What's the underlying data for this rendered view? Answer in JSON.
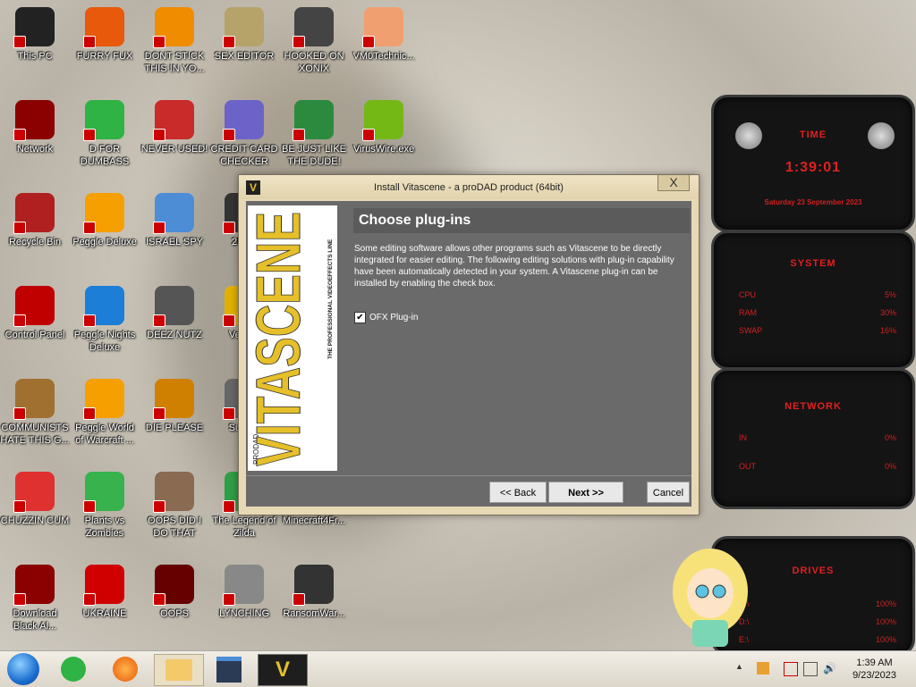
{
  "desktop": {
    "icons": [
      {
        "label": "This PC",
        "name": "this-pc-icon",
        "color": "#222"
      },
      {
        "label": "FURRY FUX",
        "name": "firefox-icon",
        "color": "#e8590c"
      },
      {
        "label": "DONT STICK THIS IN YO...",
        "name": "vlc-icon",
        "color": "#f08c00"
      },
      {
        "label": "SEX EDITOR",
        "name": "hxd-icon",
        "color": "#b5a36a"
      },
      {
        "label": "HOOKED ON XONIX",
        "name": "xonix-icon",
        "color": "#444"
      },
      {
        "label": "VM0Technic...",
        "name": "doctor-icon",
        "color": "#f0a070"
      },
      {
        "label": "Network",
        "name": "network-icon",
        "color": "#8b0000"
      },
      {
        "label": "D FOR DUMBASS",
        "name": "docs-icon",
        "color": "#2fb344"
      },
      {
        "label": "NEVER USED!",
        "name": "devcpp-icon",
        "color": "#c92a2a"
      },
      {
        "label": "CREDIT CARD CHECKER",
        "name": "credit-card-icon",
        "color": "#6c63c9"
      },
      {
        "label": "BE JUST LIKE THE DUDE!",
        "name": "santa-icon",
        "color": "#2b8a3e"
      },
      {
        "label": "VirusWire.exe",
        "name": "lime-icon",
        "color": "#74b816"
      },
      {
        "label": "Recycle Bin",
        "name": "recycle-bin-icon",
        "color": "#b02020"
      },
      {
        "label": "Peggle Deluxe",
        "name": "peggle-icon",
        "color": "#f59f00"
      },
      {
        "label": "ISRAEL SPY",
        "name": "spy-icon",
        "color": "#4c8dd6"
      },
      {
        "label": "2PAC",
        "name": "pac-icon",
        "color": "#333"
      },
      {
        "label": "Control Panel",
        "name": "control-panel-icon",
        "color": "#c00000"
      },
      {
        "label": "Peggle Nights Deluxe",
        "name": "peggle-nights-icon",
        "color": "#1c7ed6"
      },
      {
        "label": "DEEZ NUTZ",
        "name": "deez-icon",
        "color": "#555"
      },
      {
        "label": "Vega...",
        "name": "vegas-icon",
        "color": "#e0b000"
      },
      {
        "label": "COMMUNISTS HATE THIS G...",
        "name": "money-bag-icon",
        "color": "#a07030"
      },
      {
        "label": "Peggle World of Warcraft ...",
        "name": "peggle-wow-icon",
        "color": "#f59f00"
      },
      {
        "label": "DIE PLEASE",
        "name": "de-icon",
        "color": "#d08000"
      },
      {
        "label": "Supe...",
        "name": "super-icon",
        "color": "#666"
      },
      {
        "label": "CHUZZIN CUM",
        "name": "chuzzle-icon",
        "color": "#e03131"
      },
      {
        "label": "Plants vs Zombies",
        "name": "pvz-icon",
        "color": "#37b24d"
      },
      {
        "label": "OOPS DID I DO THAT",
        "name": "portrait-icon",
        "color": "#8a6a50"
      },
      {
        "label": "The Legend of Zilda",
        "name": "zelda-icon",
        "color": "#2f9e44"
      },
      {
        "label": "Minecraft4Fr...",
        "name": "minecraft-icon",
        "color": "#6a4b2a"
      },
      {
        "label": "Download Black Al...",
        "name": "download-icon",
        "color": "#8b0000"
      },
      {
        "label": "UKRAINE",
        "name": "radiation-icon",
        "color": "#d00000"
      },
      {
        "label": "OOPS",
        "name": "oops-icon",
        "color": "#660000"
      },
      {
        "label": "LYNCHING",
        "name": "noose-icon",
        "color": "#888"
      },
      {
        "label": "RansomWar...",
        "name": "skull-icon",
        "color": "#333"
      }
    ]
  },
  "installer": {
    "title": "Install Vitascene - a proDAD product   (64bit)",
    "close": "X",
    "logo_letter": "V",
    "brand_vertical": "VITASCENE",
    "brand_sub": "THE PROFESSIONAL VIDEOEFFECTS LINE",
    "brand_prefix": "PRODAD",
    "heading": "Choose plug-ins",
    "description": "Some editing software allows other programs such as Vitascene to be directly integrated for easier editing.  The following editing solutions with plug-in capability have been automatically detected in your system. A Vitascene plug-in can be installed by enabling the check box.",
    "checkbox_label": "OFX Plug-in",
    "checkbox_checked": "✔",
    "back_label": "<< Back",
    "next_label": "Next >>",
    "cancel_label": "Cancel"
  },
  "widgets": {
    "time": {
      "title": "TIME",
      "clock": "1:39:01",
      "date": "Saturday 23 September 2023"
    },
    "system": {
      "title": "SYSTEM",
      "rows": [
        {
          "label": "CPU",
          "value": "5%"
        },
        {
          "label": "RAM",
          "value": "30%"
        },
        {
          "label": "SWAP",
          "value": "16%"
        }
      ]
    },
    "network": {
      "title": "NETWORK",
      "rows": [
        {
          "label": "IN",
          "value": "0%"
        },
        {
          "label": "OUT",
          "value": "0%"
        }
      ]
    },
    "drives": {
      "title": "DRIVES",
      "rows": [
        {
          "label": "C:\\",
          "value": "100%"
        },
        {
          "label": "D:\\",
          "value": "100%"
        },
        {
          "label": "E:\\",
          "value": "100%"
        }
      ]
    }
  },
  "taskbar": {
    "time": "1:39 AM",
    "date": "9/23/2023"
  }
}
